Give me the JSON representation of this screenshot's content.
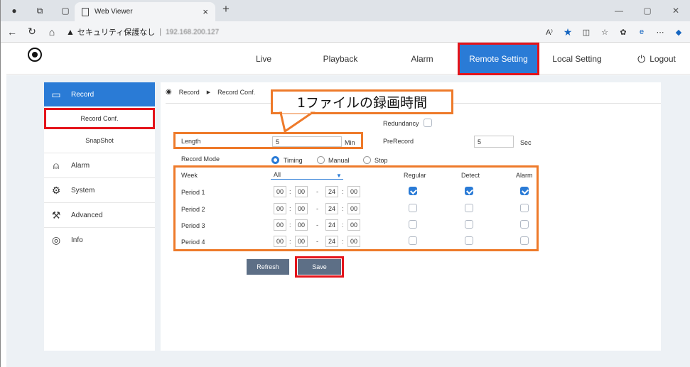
{
  "browser": {
    "tab_title": "Web Viewer",
    "tab_close": "×",
    "new_tab": "+",
    "security_text": "セキュリティ保護なし",
    "address_sep": "|",
    "host": "192.168.200.127"
  },
  "header": {
    "menus": [
      "Live",
      "Playback",
      "Alarm",
      "Remote Setting",
      "Local Setting",
      "Logout"
    ],
    "active": "Remote Setting"
  },
  "sidebar": {
    "items": [
      {
        "label": "Record",
        "icon": "record-camera-icon"
      },
      {
        "label": "Alarm",
        "icon": "alarm-icon"
      },
      {
        "label": "System",
        "icon": "system-gear-icon"
      },
      {
        "label": "Advanced",
        "icon": "advanced-wrench-icon"
      },
      {
        "label": "Info",
        "icon": "info-gauge-icon"
      }
    ],
    "subitems": [
      "Record Conf.",
      "SnapShot"
    ]
  },
  "breadcrumb": {
    "root": "Record",
    "arrow": "▶",
    "page": "Record Conf."
  },
  "callout": "1ファイルの録画時間",
  "form": {
    "redundancy_label": "Redundancy",
    "length_label": "Length",
    "length_value": "5",
    "length_unit": "Min",
    "prerecord_label": "PreRecord",
    "prerecord_value": "5",
    "prerecord_unit": "Sec",
    "record_mode_label": "Record Mode",
    "modes": [
      "Timing",
      "Manual",
      "Stop"
    ],
    "mode_selected": "Timing",
    "week_label": "Week",
    "week_value": "All",
    "col_regular": "Regular",
    "col_detect": "Detect",
    "col_alarm": "Alarm",
    "time_sep": ":",
    "range_sep": "-",
    "periods": [
      {
        "label": "Period 1",
        "start_h": "00",
        "start_m": "00",
        "end_h": "24",
        "end_m": "00",
        "regular": true,
        "detect": true,
        "alarm": true
      },
      {
        "label": "Period 2",
        "start_h": "00",
        "start_m": "00",
        "end_h": "24",
        "end_m": "00",
        "regular": false,
        "detect": false,
        "alarm": false
      },
      {
        "label": "Period 3",
        "start_h": "00",
        "start_m": "00",
        "end_h": "24",
        "end_m": "00",
        "regular": false,
        "detect": false,
        "alarm": false
      },
      {
        "label": "Period 4",
        "start_h": "00",
        "start_m": "00",
        "end_h": "24",
        "end_m": "00",
        "regular": false,
        "detect": false,
        "alarm": false
      }
    ]
  },
  "buttons": {
    "refresh": "Refresh",
    "save": "Save"
  },
  "colors": {
    "accent": "#2a7bd6",
    "highlight_red": "#e4141b",
    "callout_orange": "#ee7a2a"
  }
}
